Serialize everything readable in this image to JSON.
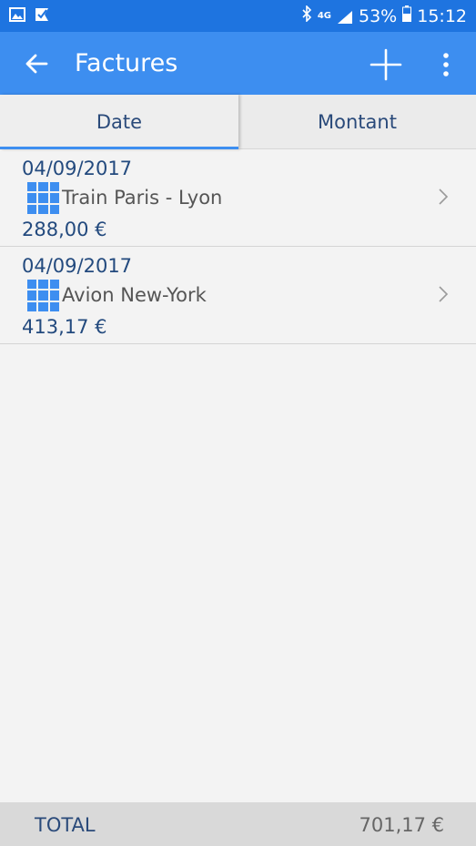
{
  "statusbar": {
    "battery": "53%",
    "time": "15:12",
    "network": "4G"
  },
  "appbar": {
    "title": "Factures"
  },
  "tabs": [
    {
      "label": "Date",
      "selected": true
    },
    {
      "label": "Montant",
      "selected": false
    }
  ],
  "invoices": [
    {
      "date": "04/09/2017",
      "name": "Train Paris - Lyon",
      "amount": "288,00 €"
    },
    {
      "date": "04/09/2017",
      "name": "Avion New-York",
      "amount": "413,17 €"
    }
  ],
  "footer": {
    "total_label": "TOTAL",
    "total_value": "701,17 €"
  },
  "colors": {
    "statusbar": "#1e74e0",
    "appbar": "#3d8ef0",
    "accent": "#3d8ef0",
    "text_dark_blue": "#234a7e"
  }
}
